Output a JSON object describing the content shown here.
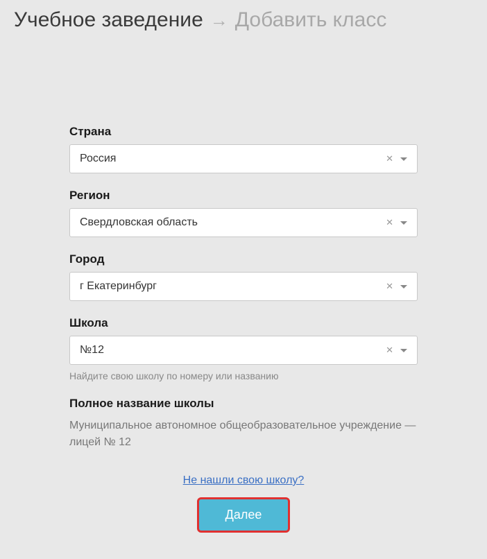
{
  "breadcrumb": {
    "current": "Учебное заведение",
    "next": "Добавить класс"
  },
  "form": {
    "country": {
      "label": "Страна",
      "value": "Россия"
    },
    "region": {
      "label": "Регион",
      "value": "Свердловская область"
    },
    "city": {
      "label": "Город",
      "value": "г Екатеринбург"
    },
    "school": {
      "label": "Школа",
      "value": "№12",
      "hint": "Найдите свою школу по номеру или названию"
    },
    "fullname": {
      "label": "Полное название школы",
      "value": "Муниципальное автономное общеобразовательное учреждение — лицей № 12"
    }
  },
  "help_link": "Не нашли свою школу?",
  "next_button": "Далее"
}
